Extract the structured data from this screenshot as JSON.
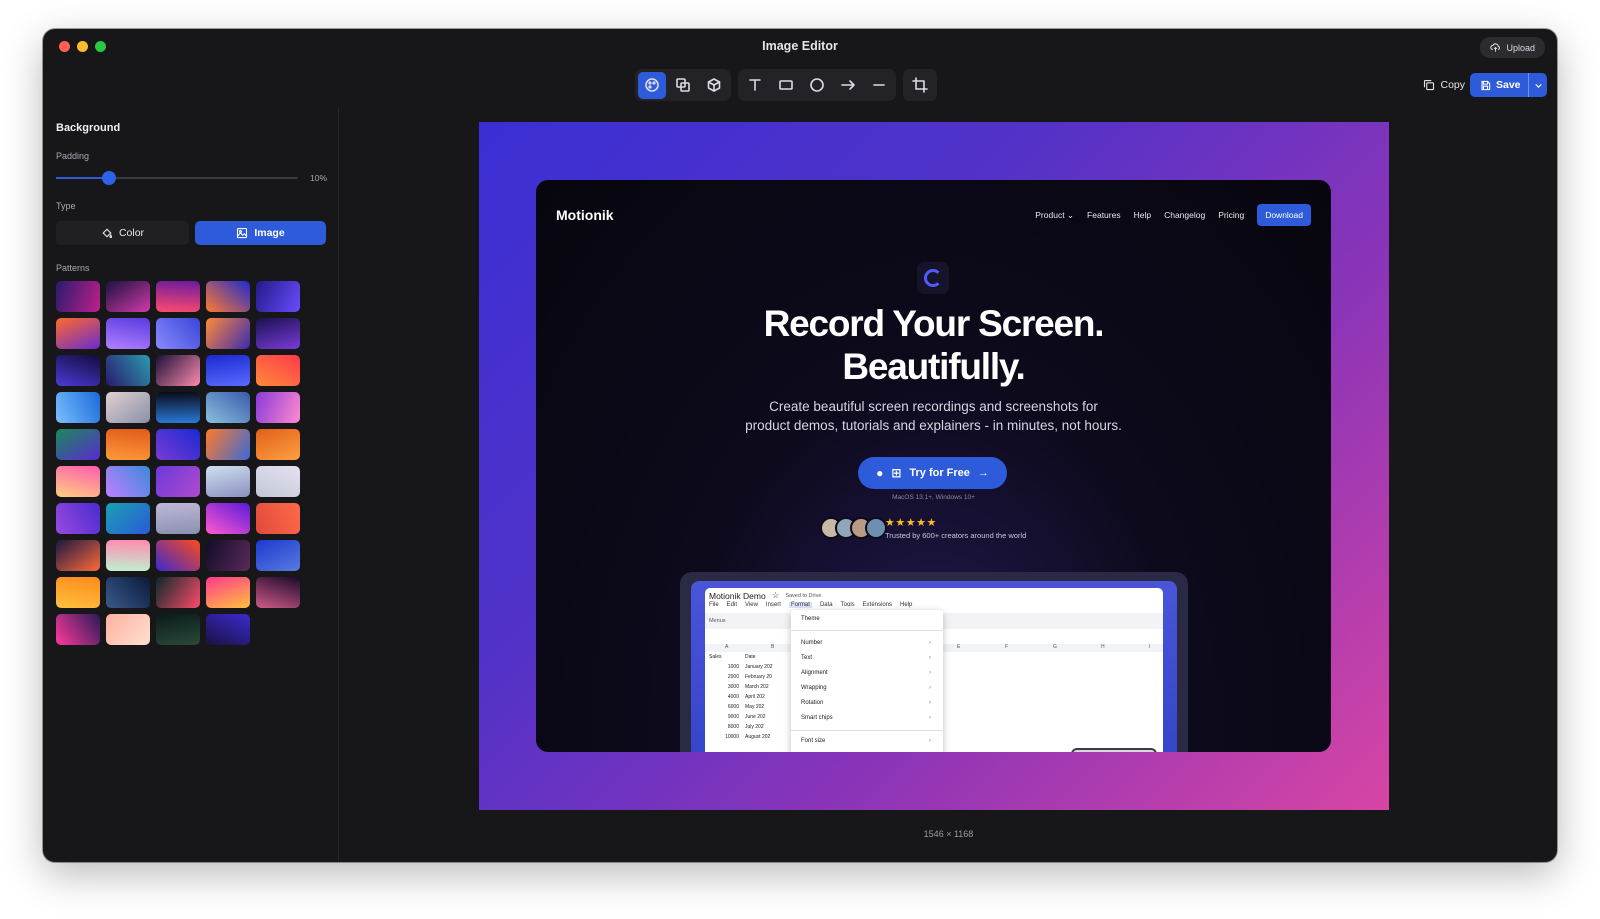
{
  "window": {
    "title": "Image Editor",
    "upload_label": "Upload"
  },
  "toolbar": {
    "tools": [
      "background-icon",
      "layers-icon",
      "3d-box-icon",
      "text-icon",
      "rectangle-icon",
      "circle-icon",
      "arrow-icon",
      "line-icon",
      "crop-icon"
    ],
    "copy_label": "Copy",
    "save_label": "Save"
  },
  "sidebar": {
    "section_title": "Background",
    "padding_label": "Padding",
    "padding_value": "10%",
    "padding_fraction": 0.22,
    "type_label": "Type",
    "type_options": [
      "Color",
      "Image"
    ],
    "type_selected": "Image",
    "patterns_label": "Patterns",
    "pattern_count": 49
  },
  "preview": {
    "brand": "Motionik",
    "nav": [
      "Product ⌄",
      "Features",
      "Help",
      "Changelog",
      "Pricing"
    ],
    "download_label": "Download",
    "hero_line1": "Record Your Screen.",
    "hero_line2": "Beautifully.",
    "sub_line1": "Create beautiful screen recordings and screenshots for",
    "sub_line2": "product demos, tutorials and explainers - in minutes, not hours.",
    "cta_label": "Try for Free",
    "requirements": "MacOS 13.1+, Windows 10+",
    "stars": "★★★★★",
    "trusted": "Trusted by 600+ creators around the world",
    "sheet": {
      "title": "Motionik Demo",
      "saved": "Saved to Drive",
      "menu": [
        "File",
        "Edit",
        "View",
        "Insert",
        "Format",
        "Data",
        "Tools",
        "Extensions",
        "Help"
      ],
      "toolbar_label": "Menus",
      "columns": [
        "A",
        "B",
        "",
        "",
        "",
        "",
        "E",
        "F",
        "G",
        "H",
        "I"
      ],
      "header_row": [
        "Sales",
        "Date"
      ],
      "rows": [
        [
          "1000",
          "January 202"
        ],
        [
          "2000",
          "February 20"
        ],
        [
          "3000",
          "March 202"
        ],
        [
          "4000",
          "April 202"
        ],
        [
          "6000",
          "May 202"
        ],
        [
          "9000",
          "June 202"
        ],
        [
          "8000",
          "July 202"
        ],
        [
          "10000",
          "August 202"
        ]
      ],
      "format_menu": [
        "Theme",
        "Number",
        "Text",
        "Alignment",
        "Wrapping",
        "Rotation",
        "Smart chips",
        "Font size"
      ]
    }
  },
  "canvas": {
    "dimensions": "1546 × 1168"
  },
  "colors": {
    "accent": "#2d5bd9",
    "window_bg": "#17171a",
    "star": "#fbbf24"
  }
}
